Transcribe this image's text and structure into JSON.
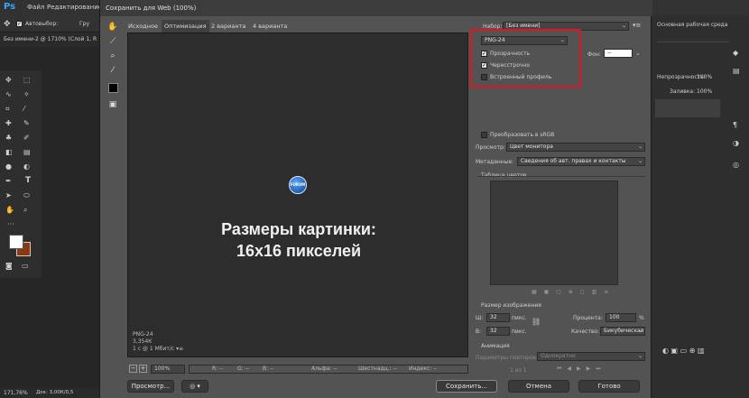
{
  "ps": {
    "logo": "Ps",
    "menu": [
      "Файл",
      "Редактирование"
    ],
    "options": {
      "autoselect": "Автовыбор:",
      "group": "Гру"
    },
    "doc_tab": "Без имени-2 @ 1710% (Слой 1, R",
    "status": "171,76%",
    "status_doc": "Док: 3,00К/0,5",
    "right_panel": {
      "workspace": "Основная рабочая среда",
      "opacity_label": "Непрозрачность:",
      "opacity_value": "100%",
      "fill_label": "Заливка:",
      "fill_value": "100%"
    }
  },
  "dialog": {
    "title": "Сохранить для Web (100%)",
    "tabs": [
      "Исходное",
      "Оптимизация",
      "2 варианта",
      "4 варианта"
    ],
    "active_tab": 1,
    "preview": {
      "icon_text": "FORUM",
      "caption_line1": "Размеры картинки:",
      "caption_line2": "16х16 пикселей",
      "info_format": "PNG-24",
      "info_size": "3,354К",
      "info_speed": "1 с @ 1 Мбит/с"
    },
    "zoom_bar": {
      "zoom": "100%",
      "r": "R: --",
      "g": "G: --",
      "b": "B: --",
      "alpha": "Альфа: --",
      "hex": "Шестнадц.: --",
      "index": "Индекс: --"
    },
    "buttons": {
      "preview": "Просмотр...",
      "save": "Сохранить...",
      "cancel": "Отмена",
      "done": "Готово"
    },
    "settings": {
      "preset_label": "Набор:",
      "preset_value": "[Без имени]",
      "format": "PNG-24",
      "transparency": "Прозрачность",
      "interlaced": "Чересстрочно",
      "embedded_profile": "Встроенный профиль",
      "matte_label": "Фон:",
      "matte_value": "--",
      "convert_srgb": "Преобразовать в sRGB",
      "preview_label": "Просмотр:",
      "preview_value": "Цвет монитора",
      "metadata_label": "Метаданные:",
      "metadata_value": "Сведения об авт. правах и контакты",
      "color_table": "Таблица цветов",
      "image_size": "Размер изображения",
      "w_label": "Ш:",
      "w_value": "32",
      "h_label": "В:",
      "h_value": "32",
      "unit": "пикс.",
      "percent_label": "Процента:",
      "percent_value": "100",
      "percent_sign": "%",
      "quality_label": "Качество:",
      "quality_value": "Бикубическая",
      "animation": "Анимация",
      "loop_label": "Параметры повторов:",
      "loop_value": "Однократно",
      "frame_counter": "1 из 1"
    }
  }
}
